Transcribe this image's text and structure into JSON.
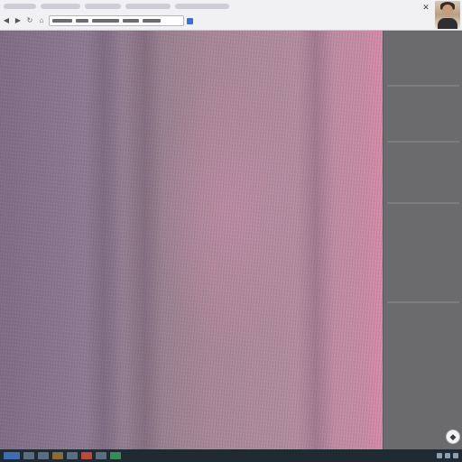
{
  "browser": {
    "tabs": [
      {
        "name": "tab-1"
      },
      {
        "name": "tab-2"
      },
      {
        "name": "tab-3"
      },
      {
        "name": "tab-4"
      },
      {
        "name": "tab-5"
      }
    ],
    "icons": {
      "back": "back-arrow-icon",
      "forward": "forward-arrow-icon",
      "reload": "reload-icon",
      "home": "home-icon",
      "close": "close-icon"
    }
  },
  "canvas": {
    "colors": {
      "left": "#7f6e85",
      "middle": "#a98897",
      "right_edge": "#d98aa7"
    }
  },
  "side_panel": {
    "background": "#6b6b6e"
  },
  "taskbar": {
    "background": "#1f2a33"
  },
  "overlay_button": {
    "icon": "assistant-icon"
  }
}
